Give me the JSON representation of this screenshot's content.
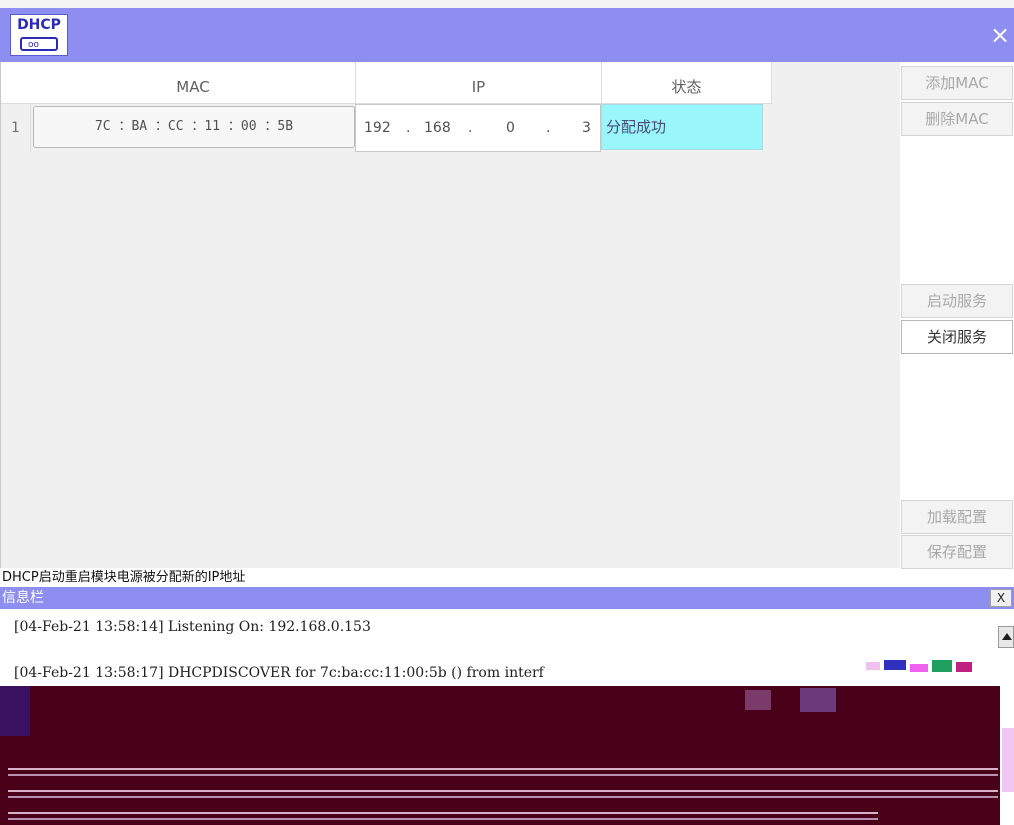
{
  "titlebar": {
    "logo_text": "DHCP",
    "logo_sub": "oo",
    "close": "×"
  },
  "table": {
    "headers": [
      "MAC",
      "IP",
      "状态"
    ],
    "rows": [
      {
        "index": "1",
        "mac": "7C ：BA ：CC ：11 ：00 ：5B",
        "ip": [
          "192",
          ".",
          "168",
          ".",
          "0",
          ".",
          "3"
        ],
        "status": "分配成功"
      }
    ]
  },
  "sidebar": {
    "add_mac": "添加MAC",
    "delete_mac": "删除MAC",
    "start_service": "启动服务",
    "stop_service": "关闭服务",
    "load_config": "加载配置",
    "save_config": "保存配置"
  },
  "message": "DHCP启动重启模块电源被分配新的IP地址",
  "infobar": {
    "title": "信息栏",
    "close": "X"
  },
  "log": [
    "[04-Feb-21 13:58:14] Listening On: 192.168.0.153",
    "[04-Feb-21 13:58:17] DHCPDISCOVER for 7c:ba:cc:11:00:5b () from interf"
  ],
  "colors": {
    "titlebar": "#8e8ef0",
    "status_bg": "#99f7fb",
    "glitch": "#4a0018"
  }
}
